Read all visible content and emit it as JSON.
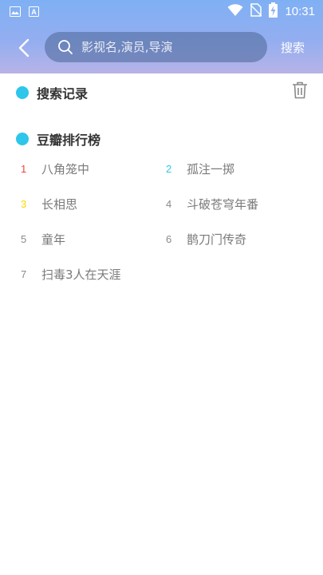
{
  "status_bar": {
    "time": "10:31",
    "left_icons": [
      "gallery-icon",
      "font-a-icon"
    ],
    "right_icons": [
      "wifi-icon",
      "no-sim-icon",
      "battery-charging-icon"
    ]
  },
  "header": {
    "search_placeholder": "影视名,演员,导演",
    "search_button": "搜索",
    "gradient_top": "#7fb0f4",
    "gradient_bottom": "#b7b3e8"
  },
  "history": {
    "title": "搜索记录",
    "clear_icon": "trash-icon"
  },
  "ranking": {
    "title": "豆瓣排行榜",
    "accent": "#2ec6ea",
    "items": [
      {
        "rank": "1",
        "title": "八角笼中",
        "color": "#f44336"
      },
      {
        "rank": "2",
        "title": "孤注一掷",
        "color": "#2ec6ea"
      },
      {
        "rank": "3",
        "title": "长相思",
        "color": "#ffd600"
      },
      {
        "rank": "4",
        "title": "斗破苍穹年番",
        "color": "#8a8a8a"
      },
      {
        "rank": "5",
        "title": "童年",
        "color": "#8a8a8a"
      },
      {
        "rank": "6",
        "title": "鹊刀门传奇",
        "color": "#8a8a8a"
      },
      {
        "rank": "7",
        "title": "扫毒3人在天涯",
        "color": "#8a8a8a"
      }
    ]
  }
}
